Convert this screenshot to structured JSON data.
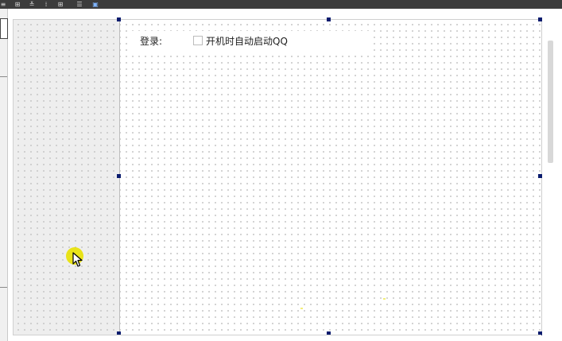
{
  "toolbar": {
    "icons": [
      "align-left-icon",
      "align-right-icon",
      "distribute-icon",
      "layout-vertical-icon",
      "layout-grid-icon",
      "layout-form-icon",
      "preview-icon"
    ]
  },
  "form": {
    "login_label": "登录:",
    "autostart_checkbox_label": "开机时自动启动QQ",
    "autostart_checked": false
  },
  "colors": {
    "toolbar_bg": "#3c3c3c",
    "selection_handle": "#0b1c6e",
    "cursor_highlight": "#e8e100"
  }
}
